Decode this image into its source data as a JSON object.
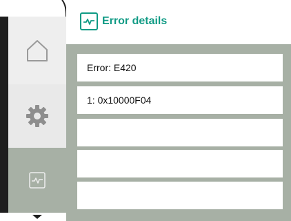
{
  "header": {
    "title": "Error details",
    "icon": "heartbeat-icon",
    "accent_color": "#0f9a84"
  },
  "nav": {
    "items": [
      {
        "name": "home",
        "icon": "home-icon",
        "active": false
      },
      {
        "name": "settings",
        "icon": "gear-icon",
        "active": false
      },
      {
        "name": "error",
        "icon": "heartbeat-icon",
        "active": true
      }
    ],
    "scroll_indicator": "chevron-down-icon"
  },
  "error_rows": [
    {
      "text": "Error: E420"
    },
    {
      "text": "1: 0x10000F04"
    },
    {
      "text": ""
    },
    {
      "text": ""
    },
    {
      "text": ""
    }
  ],
  "colors": {
    "background": "#a7b0a5",
    "row_bg": "#ffffff",
    "rail_dark": "#1e1e1e"
  }
}
